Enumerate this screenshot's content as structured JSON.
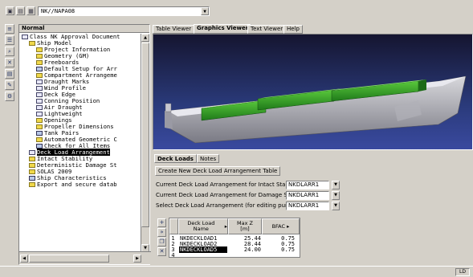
{
  "toolbar": {
    "path": "NK//NAPA08"
  },
  "tree": {
    "header": "Normal",
    "items": [
      {
        "label": "Class NK Approval Document",
        "depth": 0,
        "icon": "doc"
      },
      {
        "label": "Ship Model",
        "depth": 1,
        "icon": "folder"
      },
      {
        "label": "Project Information",
        "depth": 2,
        "icon": "folder"
      },
      {
        "label": "Geometry (GM)",
        "depth": 2,
        "icon": "folder"
      },
      {
        "label": "Freeboards",
        "depth": 2,
        "icon": "folder"
      },
      {
        "label": "Default Setup for Arr",
        "depth": 2,
        "icon": "tbl"
      },
      {
        "label": "Compartment Arrangeme",
        "depth": 2,
        "icon": "folder"
      },
      {
        "label": "Draught Marks",
        "depth": 2,
        "icon": "doc"
      },
      {
        "label": "Wind Profile",
        "depth": 2,
        "icon": "doc"
      },
      {
        "label": "Deck Edge",
        "depth": 2,
        "icon": "doc"
      },
      {
        "label": "Conning Position",
        "depth": 2,
        "icon": "doc"
      },
      {
        "label": "Air Draught",
        "depth": 2,
        "icon": "doc"
      },
      {
        "label": "Lightweight",
        "depth": 2,
        "icon": "doc"
      },
      {
        "label": "Openings",
        "depth": 2,
        "icon": "folder"
      },
      {
        "label": "Propeller Dimensions",
        "depth": 2,
        "icon": "folder"
      },
      {
        "label": "Tank Pairs",
        "depth": 2,
        "icon": "tbl"
      },
      {
        "label": "Automated Geometric C",
        "depth": 2,
        "icon": "folder"
      },
      {
        "label": "Check for All Items",
        "depth": 2,
        "icon": "tbl"
      },
      {
        "label": "Deck Load Arrangement",
        "depth": 1,
        "icon": "doc",
        "selected": true
      },
      {
        "label": "Intact Stability",
        "depth": 1,
        "icon": "folder"
      },
      {
        "label": "Deterministic Damage St",
        "depth": 1,
        "icon": "folder"
      },
      {
        "label": "SOLAS 2009",
        "depth": 1,
        "icon": "folder"
      },
      {
        "label": "Ship Characteristics",
        "depth": 1,
        "icon": "tbl"
      },
      {
        "label": "Export and secure datab",
        "depth": 1,
        "icon": "folder"
      }
    ]
  },
  "tabs": [
    {
      "label": "Table Viewer",
      "active": false
    },
    {
      "label": "Graphics Viewer",
      "active": true
    },
    {
      "label": "Text Viewer",
      "active": false
    },
    {
      "label": "Help",
      "active": false
    }
  ],
  "bottom": {
    "subtabs": [
      {
        "label": "Deck Loads",
        "active": true
      },
      {
        "label": "Notes",
        "active": false
      }
    ],
    "create_button": "Create New Deck Load Arrangement Table",
    "rows": [
      {
        "label": "Current Deck Load Arrangement for Intact Stability",
        "value": "NKDLARR1"
      },
      {
        "label": "Current Deck Load Arrangement for Damage Stability",
        "value": "NKDLARR1"
      },
      {
        "label": "Select Deck Load Arrangement (for editing purpose)",
        "value": "NKDLARR1"
      }
    ],
    "grid": {
      "headers": {
        "name": "Deck Load Name",
        "maxz": "Max Z",
        "maxz_unit": "[m]",
        "bfac": "BFAC"
      },
      "rows": [
        {
          "n": "1",
          "name": "NKDECKLOAD1",
          "maxz": "25.44",
          "bfac": "0.75"
        },
        {
          "n": "2",
          "name": "NKDECKLOAD2",
          "maxz": "28.44",
          "bfac": "0.75"
        },
        {
          "n": "3",
          "name": "NKDECKLOAD5",
          "maxz": "24.00",
          "bfac": "0.75",
          "selected": true
        },
        {
          "n": "4",
          "name": "",
          "maxz": "",
          "bfac": ""
        }
      ]
    }
  },
  "status": {
    "cell": "LD"
  }
}
